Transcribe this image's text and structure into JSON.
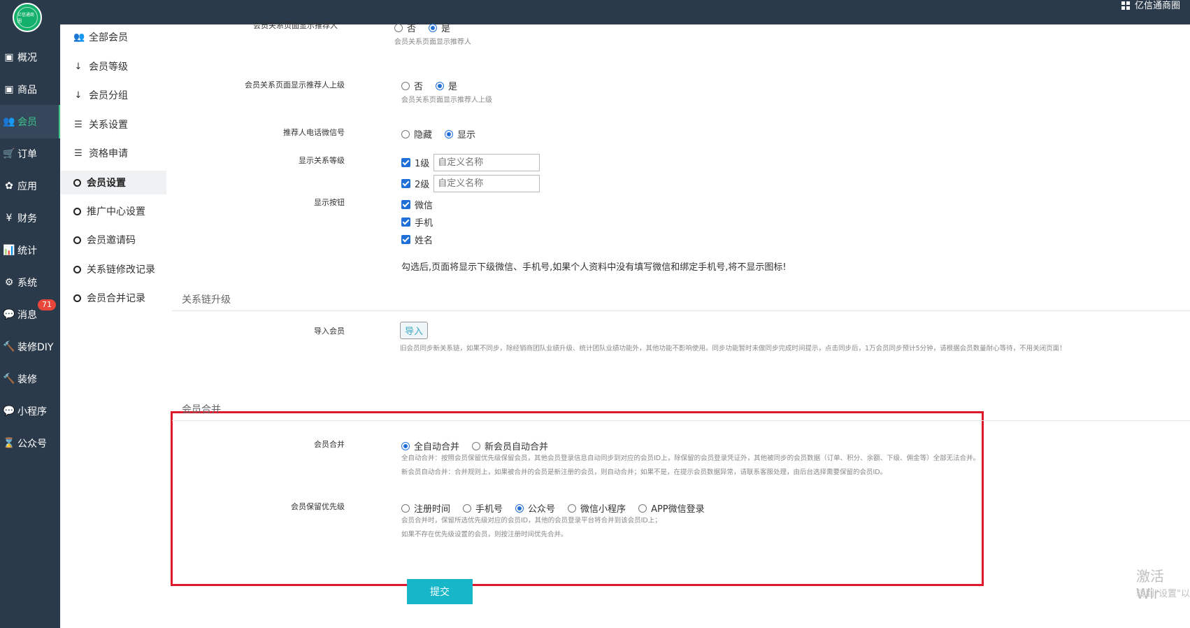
{
  "header": {
    "store_name": "亿信通商圈"
  },
  "logo": {
    "text": "亿信通商圈"
  },
  "nav": [
    {
      "icon": "dashboard-icon",
      "glyph": "▣",
      "label": "概况",
      "active": false
    },
    {
      "icon": "goods-icon",
      "glyph": "▣",
      "label": "商品",
      "active": false
    },
    {
      "icon": "members-icon",
      "glyph": "👥",
      "label": "会员",
      "active": true
    },
    {
      "icon": "cart-icon",
      "glyph": "🛒",
      "label": "订单",
      "active": false
    },
    {
      "icon": "apps-icon",
      "glyph": "✿",
      "label": "应用",
      "active": false
    },
    {
      "icon": "yen-icon",
      "glyph": "¥",
      "label": "财务",
      "active": false
    },
    {
      "icon": "stats-icon",
      "glyph": "📊",
      "label": "统计",
      "active": false
    },
    {
      "icon": "gears-icon",
      "glyph": "⚙",
      "label": "系统",
      "active": false
    },
    {
      "icon": "message-icon",
      "glyph": "💬",
      "label": "消息",
      "active": false,
      "badge": "71"
    },
    {
      "icon": "hammer-icon",
      "glyph": "🔨",
      "label": "装修DIY",
      "active": false
    },
    {
      "icon": "hammer-icon",
      "glyph": "🔨",
      "label": "装修",
      "active": false
    },
    {
      "icon": "wechat-icon",
      "glyph": "💬",
      "label": "小程序",
      "active": false
    },
    {
      "icon": "hourglass-icon",
      "glyph": "⌛",
      "label": "公众号",
      "active": false
    }
  ],
  "submenu": [
    {
      "icon": "users-icon",
      "glyph": "👥",
      "label": "全部会员",
      "active": false
    },
    {
      "icon": "sort-icon",
      "glyph": "↓",
      "label": "会员等级",
      "active": false
    },
    {
      "icon": "sort-num-icon",
      "glyph": "↓",
      "label": "会员分组",
      "active": false
    },
    {
      "icon": "sliders-icon",
      "glyph": "☰",
      "label": "关系设置",
      "active": false
    },
    {
      "icon": "sliders-icon",
      "glyph": "☰",
      "label": "资格申请",
      "active": false
    },
    {
      "icon": "circle-icon",
      "glyph": "",
      "label": "会员设置",
      "active": true
    },
    {
      "icon": "circle-icon",
      "glyph": "",
      "label": "推广中心设置",
      "active": false
    },
    {
      "icon": "circle-icon",
      "glyph": "",
      "label": "会员邀请码",
      "active": false
    },
    {
      "icon": "circle-icon",
      "glyph": "",
      "label": "关系链修改记录",
      "active": false
    },
    {
      "icon": "circle-icon",
      "glyph": "",
      "label": "会员合并记录",
      "active": false
    }
  ],
  "form": {
    "show_referrer": {
      "label": "会员关系页面显示推荐人",
      "options": [
        {
          "label": "否",
          "checked": false
        },
        {
          "label": "是",
          "checked": true
        }
      ],
      "hint": "会员关系页面显示推荐人"
    },
    "show_referrer_parent": {
      "label": "会员关系页面显示推荐人上级",
      "options": [
        {
          "label": "否",
          "checked": false
        },
        {
          "label": "是",
          "checked": true
        }
      ],
      "hint": "会员关系页面显示推荐人上级"
    },
    "referrer_phone": {
      "label": "推荐人电话微信号",
      "options": [
        {
          "label": "隐藏",
          "checked": false
        },
        {
          "label": "显示",
          "checked": true
        }
      ]
    },
    "relation_levels": {
      "label": "显示关系等级",
      "items": [
        {
          "label": "1级",
          "placeholder": "自定义名称"
        },
        {
          "label": "2级",
          "placeholder": "自定义名称"
        }
      ]
    },
    "show_buttons": {
      "label": "显示按钮",
      "items": [
        "微信",
        "手机",
        "姓名"
      ],
      "note": "勾选后,页面将显示下级微信、手机号,如果个人资料中没有填写微信和绑定手机号,将不显示图标!"
    },
    "upgrade_section": {
      "title": "关系链升级",
      "import_label": "导入会员",
      "import_button": "导入",
      "hint": "旧会员同步新关系链，如果不同步，除经销商团队业绩升级、统计团队业绩功能外，其他功能不影响使用。同步功能暂时未做同步完成时间提示，点击同步后，1万会员同步预计5分钟，请根据会员数量耐心等待，不用关闭页面！"
    },
    "merge_section": {
      "title": "会员合并",
      "merge": {
        "label": "会员合并",
        "options": [
          {
            "label": "全自动合并",
            "checked": true
          },
          {
            "label": "新会员自动合并",
            "checked": false
          }
        ],
        "hint1": "全自动合并：按照会员保留优先级保留会员，其他会员登录信息自动同步到对应的会员ID上，除保留的会员登录凭证外，其他被同步的会员数据（订单、积分、余额、下级、佣金等）全部无法合并。",
        "hint2": "新会员自动合并：合并规则上，如果被合并的会员是新注册的会员，则自动合并；如果不是，在提示会员数据异常，请联系客服处理，由后台选择需要保留的会员ID。"
      },
      "priority": {
        "label": "会员保留优先级",
        "options": [
          {
            "label": "注册时间",
            "checked": false
          },
          {
            "label": "手机号",
            "checked": false
          },
          {
            "label": "公众号",
            "checked": true
          },
          {
            "label": "微信小程序",
            "checked": false
          },
          {
            "label": "APP微信登录",
            "checked": false
          }
        ],
        "hint1": "会员合并时，保留所选优先级对应的会员ID，其他的会员登录平台将合并到该会员ID上；",
        "hint2": "如果不存在优先级设置的会员，则按注册时间优先合并。"
      }
    },
    "submit_label": "提交"
  },
  "watermark": {
    "line1": "激活 Wir",
    "line2": "转到\"设置\"以"
  }
}
